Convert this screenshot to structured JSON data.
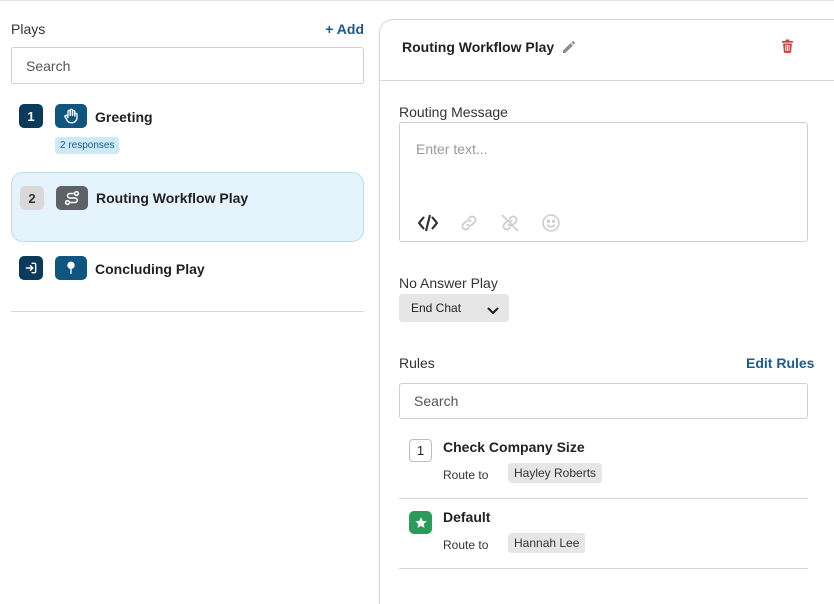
{
  "plays_panel": {
    "title": "Plays",
    "add_label": "+ Add",
    "search_placeholder": "Search",
    "items": [
      {
        "badge": "1",
        "icon": "hand-icon",
        "name": "Greeting",
        "responses": "2 responses"
      },
      {
        "badge": "2",
        "icon": "route-icon",
        "name": "Routing Workflow Play",
        "selected": true
      },
      {
        "badge_icon": "exit-icon",
        "icon": "pin-icon",
        "name": "Concluding Play"
      }
    ]
  },
  "detail": {
    "title": "Routing Workflow Play",
    "routing_message_label": "Routing Message",
    "routing_message_placeholder": "Enter text...",
    "toolbar": [
      "code-icon",
      "link-icon",
      "unlink-icon",
      "emoji-icon"
    ],
    "no_answer_label": "No Answer Play",
    "no_answer_value": "End Chat",
    "rules_label": "Rules",
    "edit_rules_label": "Edit Rules",
    "rules_search_placeholder": "Search",
    "route_to_label": "Route to",
    "rules": [
      {
        "badge": "1",
        "name": "Check Company Size",
        "route_to": "Hayley Roberts"
      },
      {
        "badge_icon": "star-icon",
        "name": "Default",
        "route_to": "Hannah Lee"
      }
    ]
  },
  "colors": {
    "accent": "#1b5a8a",
    "badge_dark": "#0c3a5a",
    "selected_bg": "#e4f3fc",
    "delete": "#d93636",
    "default_rule": "#2a9b5a"
  }
}
